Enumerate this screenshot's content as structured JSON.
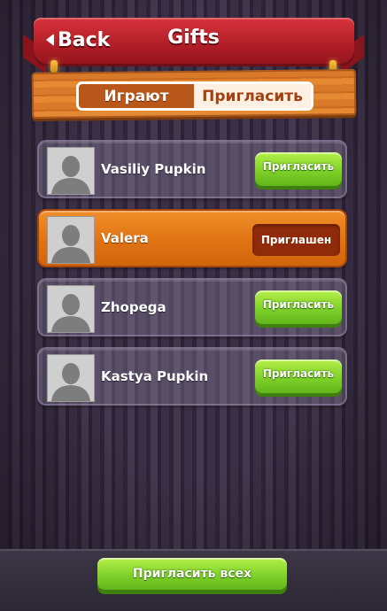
{
  "header": {
    "back_label": "Back",
    "title": "Gifts"
  },
  "tabs": [
    {
      "label": "Играют",
      "active": false
    },
    {
      "label": "Пригласить",
      "active": true
    }
  ],
  "friends": [
    {
      "name": "Vasiliy Pupkin",
      "status": "invite",
      "action_label": "Пригласить"
    },
    {
      "name": "Valera",
      "status": "invited",
      "action_label": "Приглашен"
    },
    {
      "name": "Zhopega",
      "status": "invite",
      "action_label": "Пригласить"
    },
    {
      "name": "Kastya Pupkin",
      "status": "invite",
      "action_label": "Пригласить"
    }
  ],
  "footer": {
    "invite_all_label": "Пригласить всех"
  },
  "colors": {
    "banner": "#c62a32",
    "plank": "#d97a2a",
    "invited_row": "#e07313",
    "green_button": "#7fd12a",
    "invited_badge": "#8f2a0a"
  },
  "icons": {
    "back": "back-arrow-icon",
    "avatar": "default-avatar-icon"
  }
}
